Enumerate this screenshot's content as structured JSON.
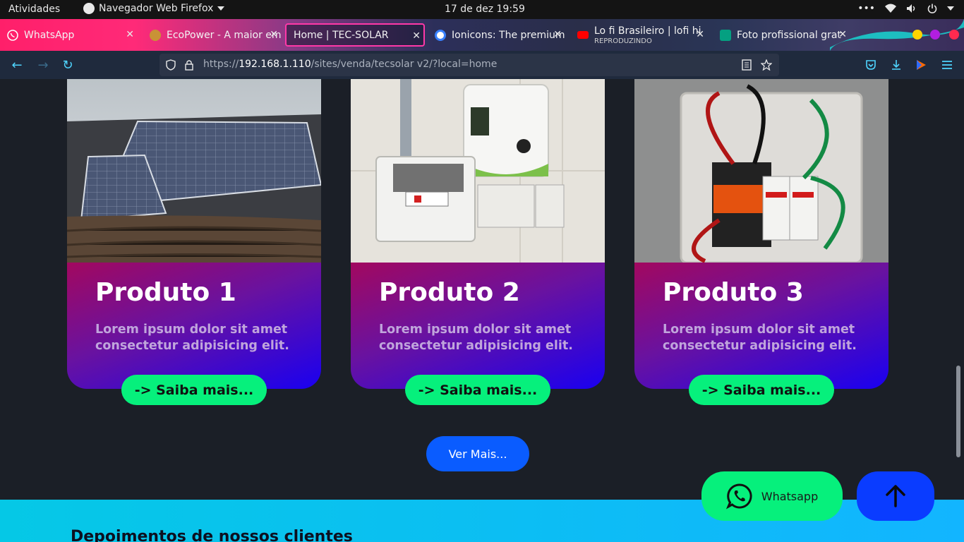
{
  "os": {
    "activities": "Atividades",
    "app_name": "Navegador Web Firefox",
    "clock": "17 de dez  19:59"
  },
  "tabs": [
    {
      "label": "WhatsApp",
      "favicon_color": "#25d366",
      "active": false
    },
    {
      "label": "EcoPower - A maior em",
      "favicon_color": "#c99236",
      "active": false
    },
    {
      "label": "Home | TEC-SOLAR",
      "active": true
    },
    {
      "label": "Ionicons: The premium",
      "favicon_color": "#3880ff",
      "active": false
    },
    {
      "label": "Lo fi Brasileiro | lofi hi",
      "sublabel": "REPRODUZINDO",
      "favicon_color": "#ff0000",
      "active": false
    },
    {
      "label": "Foto profissional grat",
      "favicon_color": "#05a081",
      "active": false
    }
  ],
  "navbar": {
    "url_prefix": "https://",
    "url_host": "192.168.1.110",
    "url_path": "/sites/venda/tecsolar v2/?local=home"
  },
  "products": [
    {
      "title": "Produto 1",
      "description": "Lorem ipsum dolor sit amet consectetur adipisicing elit.",
      "cta": "-> Saiba mais...",
      "image": "solar-panels-roof"
    },
    {
      "title": "Produto 2",
      "description": "Lorem ipsum dolor sit amet consectetur adipisicing elit.",
      "cta": "-> Saiba mais...",
      "image": "inverter-breaker-box"
    },
    {
      "title": "Produto 3",
      "description": "Lorem ipsum dolor sit amet consectetur adipisicing elit.",
      "cta": "-> Saiba mais...",
      "image": "electrical-junction-box"
    }
  ],
  "ver_mais": "Ver Mais...",
  "testimonials_heading": "Depoimentos de nossos clientes",
  "floating": {
    "whatsapp_label": "Whatsapp"
  },
  "colors": {
    "accent_green": "#06f07c",
    "accent_blue": "#0a5cff",
    "page_bg": "#1b1f27"
  }
}
